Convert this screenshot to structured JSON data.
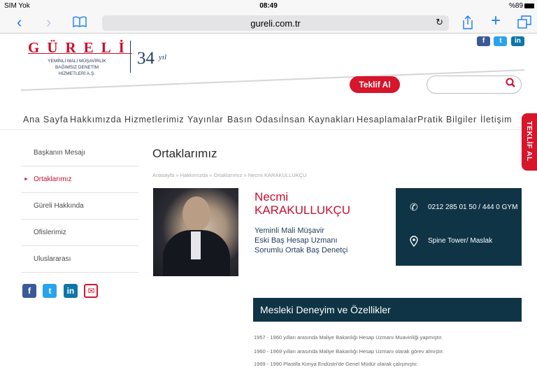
{
  "status_bar": {
    "carrier": "SIM Yok",
    "wifi_icon": "wifi-icon",
    "time": "08:49",
    "battery": "%89"
  },
  "browser": {
    "url": "gureli.com.tr",
    "reload_icon": "↻"
  },
  "brand": {
    "name": "GÜRELİ",
    "sub_lines": [
      "YEMİNLİ MALİ MÜŞAVİRLİK",
      "BAĞIMSIZ DENETİM",
      "HİZMETLERİ A.Ş."
    ],
    "years": "34",
    "years_suffix": "yıl"
  },
  "header": {
    "offer_button": "Teklif Al",
    "social": [
      "f",
      "t",
      "in"
    ],
    "search_placeholder": ""
  },
  "nav": [
    "Ana Sayfa",
    "Hakkımızda",
    "Hizmetlerimiz",
    "Yayınlar",
    "Basın Odası",
    "İnsan Kaynakları",
    "Hesaplamalar",
    "Pratik Bilgiler",
    "İletişim"
  ],
  "side_tab": "TEKLİF AL",
  "sub_menu": [
    {
      "label": "Başkanın Mesajı",
      "active": false
    },
    {
      "label": "Ortaklarımız",
      "active": true
    },
    {
      "label": "Güreli Hakkında",
      "active": false
    },
    {
      "label": "Ofislerimiz",
      "active": false
    },
    {
      "label": "Uluslararası",
      "active": false
    }
  ],
  "social_bottom": [
    "f",
    "t",
    "in",
    "✉"
  ],
  "content": {
    "title": "Ortaklarımız",
    "breadcrumb": "Anasayfa » Hakkımızda » Ortaklarımız » Necmi KARAKULLUKÇU",
    "name_first": "Necmi",
    "name_last": "KARAKULLUKÇU",
    "titles": [
      "Yeminli Mali Müşavir",
      "Eski Baş Hesap Uzmanı",
      "Sorumlu Ortak Baş Denetçi"
    ],
    "phone": "0212 285 01 50 / 444 0 GYM",
    "location": "Spine Tower/ Maslak",
    "section_title": "Mesleki Deneyim ve Özellikler",
    "experience": [
      "1957 - 1960 yılları arasında Maliye Bakanlığı Hesap Uzmanı Muavinliği yapmıştır.",
      "1960 - 1969 yılları arasında Maliye Bakanlığı Hesap Uzmanı olarak görev almıştır.",
      "1969 - 1990 Plastifa Kimya Endüstri'de Genel Müdür olarak çalışmıştır."
    ]
  },
  "colors": {
    "brand_red": "#c8102e",
    "navy": "#0f3446",
    "ios_blue": "#1a7cf5"
  }
}
